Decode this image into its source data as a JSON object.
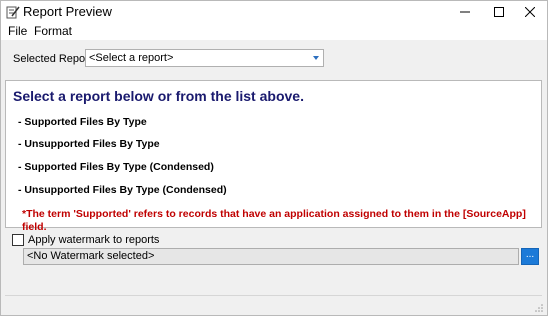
{
  "window": {
    "title": "Report Preview",
    "app_icon": "report-edit-icon",
    "controls": [
      "minimize-icon",
      "maximize-icon",
      "close-icon"
    ]
  },
  "menu": {
    "file": "File",
    "format": "Format"
  },
  "selector": {
    "label": "Selected Report:",
    "value": "<Select a report>"
  },
  "report_area": {
    "heading": "Select a report below or from the list above.",
    "links": [
      "- Supported Files By Type",
      "- Unsupported Files By Type",
      "- Supported Files By Type (Condensed)",
      "- Unsupported Files By Type (Condensed)"
    ],
    "note": "*The term 'Supported' refers to records that have an application assigned to them in the [SourceApp] field."
  },
  "watermark": {
    "checkbox_label": "Apply watermark to reports",
    "checked": false,
    "value": "<No Watermark selected>",
    "browse_label": "..."
  },
  "colors": {
    "heading": "#1a1a6e",
    "note": "#c00000",
    "accent": "#1c7ad8"
  }
}
